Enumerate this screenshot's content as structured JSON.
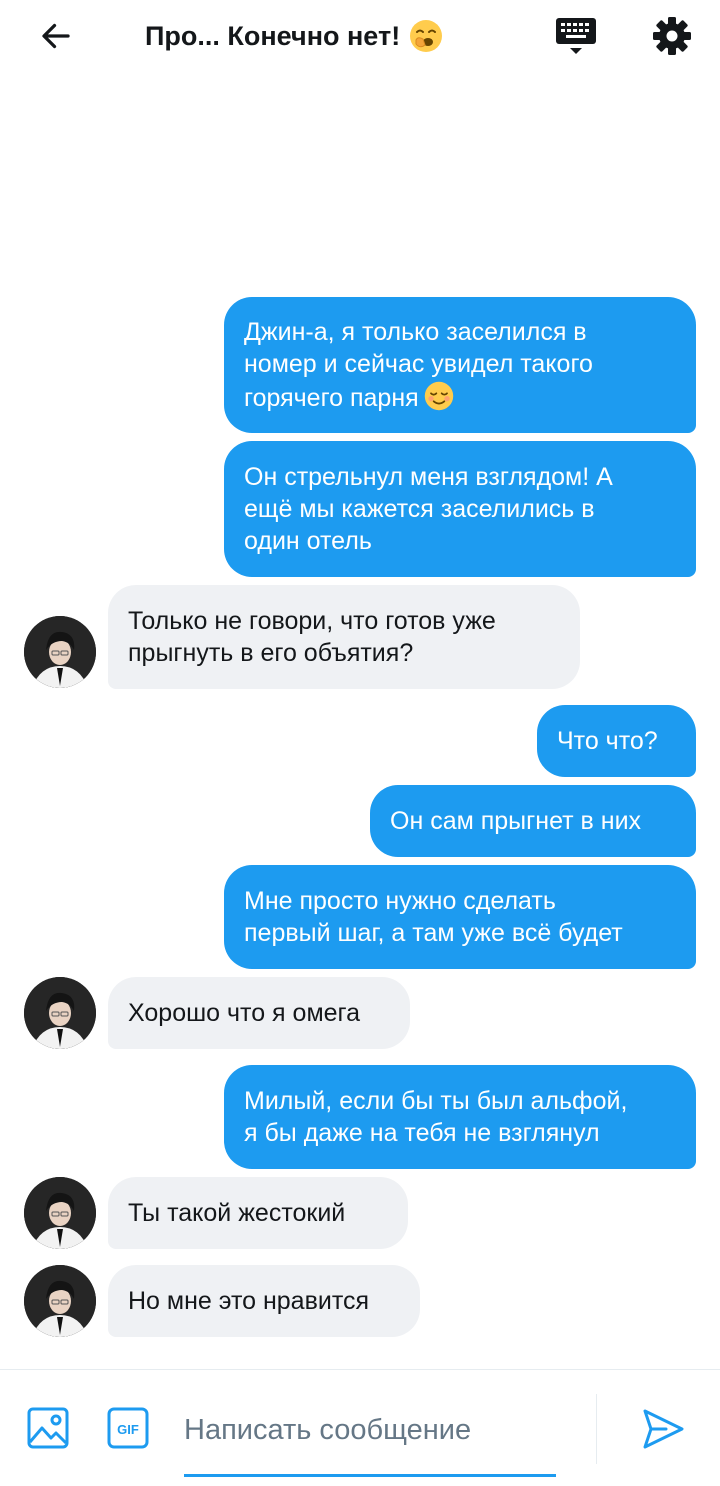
{
  "header": {
    "title": "Про... Конечно нет!",
    "title_emoji": "yawning-face"
  },
  "messages": [
    {
      "side": "out",
      "lines": [
        "Джин-а, я только заселился в",
        "номер и сейчас увидел такого",
        "горячего парня"
      ],
      "emoji": "relieved-face"
    },
    {
      "side": "out",
      "lines": [
        "Он стрельнул меня взглядом! А",
        "ещё мы кажется заселились в",
        "один отель"
      ]
    },
    {
      "side": "in",
      "lines": [
        "Только не говори, что готов уже",
        "прыгнуть в его объятия?"
      ]
    },
    {
      "side": "out",
      "lines": [
        "Что что?"
      ]
    },
    {
      "side": "out",
      "lines": [
        "Он сам прыгнет в них"
      ]
    },
    {
      "side": "out",
      "lines": [
        "Мне просто нужно сделать",
        "первый шаг, а там уже всё будет"
      ]
    },
    {
      "side": "in",
      "lines": [
        "Хорошо что я омега"
      ]
    },
    {
      "side": "out",
      "lines": [
        "Милый, если бы ты был альфой,",
        "я бы даже на тебя не взглянул"
      ]
    },
    {
      "side": "in",
      "lines": [
        "Ты такой жестокий"
      ]
    },
    {
      "side": "in",
      "lines": [
        "Но мне это нравится"
      ]
    }
  ],
  "composer": {
    "placeholder": "Написать сообщение",
    "value": "",
    "gif_label": "GIF"
  },
  "colors": {
    "accent": "#1d9bf0",
    "incoming_bubble": "#eff1f4"
  }
}
